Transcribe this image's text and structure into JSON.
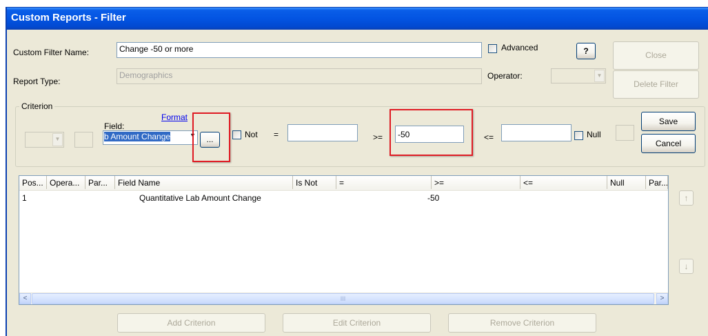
{
  "window": {
    "title": "Custom Reports - Filter"
  },
  "filter_name": {
    "label": "Custom Filter Name:",
    "value": "Change -50 or more"
  },
  "advanced": {
    "label": "Advanced",
    "checked": false
  },
  "help_label": "?",
  "close_label": "Close",
  "report_type": {
    "label": "Report Type:",
    "value": "Demographics"
  },
  "operator": {
    "label": "Operator:",
    "value": ""
  },
  "delete_filter_label": "Delete Filter",
  "criterion": {
    "group_label": "Criterion",
    "field_label": "Field:",
    "format_link": "Format",
    "field_value": "b Amount Change",
    "ellipsis_label": "...",
    "not_label": "Not",
    "eq_label": "=",
    "eq_value": "",
    "ge_label": ">=",
    "ge_value": "-50",
    "le_label": "<=",
    "le_value": "",
    "null_label": "Null",
    "save_label": "Save",
    "cancel_label": "Cancel"
  },
  "grid": {
    "columns": [
      "Pos...",
      "Opera...",
      "Par...",
      "Field Name",
      "Is Not",
      "=",
      ">=",
      "<=",
      "Null",
      "Par..."
    ],
    "rows": [
      {
        "pos": "1",
        "operator": "",
        "paren_open": "",
        "field_name": "Quantitative Lab Amount Change",
        "is_not": "",
        "eq": "",
        "ge": "-50",
        "le": "",
        "null": "",
        "paren_close": ""
      }
    ],
    "scroll_left": "<",
    "scroll_right": ">",
    "thumb_grip": "III"
  },
  "move_up_label": "↑",
  "move_down_label": "↓",
  "add_criterion_label": "Add Criterion",
  "edit_criterion_label": "Edit Criterion",
  "remove_criterion_label": "Remove Criterion"
}
